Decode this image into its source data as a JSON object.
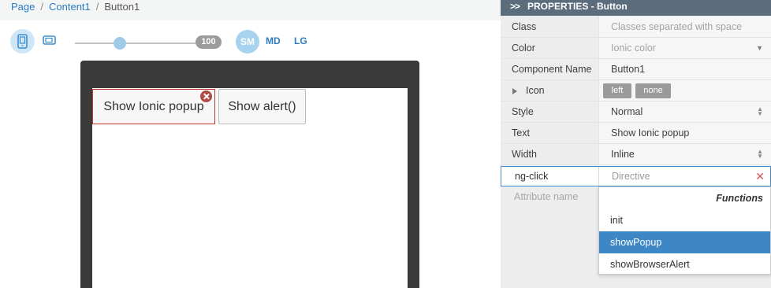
{
  "breadcrumb": {
    "items": [
      "Page",
      "Content1"
    ],
    "current": "Button1",
    "separator": "/"
  },
  "toolbar": {
    "zoom": "100",
    "zoom_slider_fraction": 0.35,
    "sizes": [
      "SM",
      "MD",
      "LG"
    ],
    "selected_size": "SM",
    "icons": [
      "phone-icon",
      "tablet-icon"
    ]
  },
  "canvas": {
    "button_selected_label": "Show Ionic popup",
    "button_alert_label": "Show alert()"
  },
  "panel": {
    "title": "PROPERTIES - Button",
    "rows": {
      "class": {
        "label": "Class",
        "value": "Classes separated with space"
      },
      "color": {
        "label": "Color",
        "value": "Ionic color"
      },
      "component_name": {
        "label": "Component Name",
        "value": "Button1"
      },
      "icon": {
        "label": "Icon",
        "chip_left": "left",
        "chip_none": "none"
      },
      "style": {
        "label": "Style",
        "value": "Normal"
      },
      "text": {
        "label": "Text",
        "value": "Show Ionic popup"
      },
      "width": {
        "label": "Width",
        "value": "Inline"
      }
    },
    "ng_click": {
      "label": "ng-click",
      "placeholder": "Directive"
    },
    "attribute_placeholder": "Attribute name",
    "dropdown": {
      "heading": "Functions",
      "items": [
        "init",
        "showPopup",
        "showBrowserAlert"
      ],
      "selected": "showPopup"
    }
  },
  "colors": {
    "accent": "#2b7bbf",
    "panel_header": "#5b6c7d",
    "selection": "#3e87c6",
    "error": "#c0392b"
  }
}
